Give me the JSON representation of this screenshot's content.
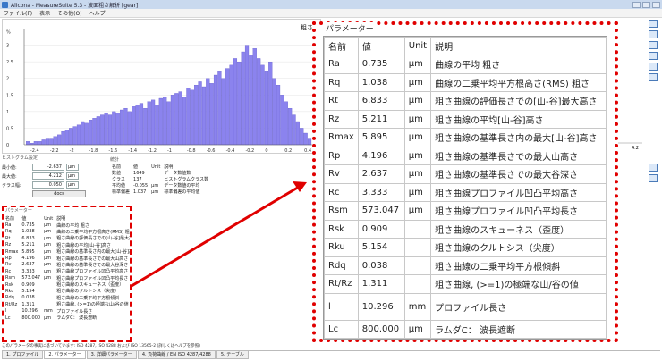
{
  "window": {
    "title": "Alicona - MeasureSuite 5.3 - 波面粗さ解析 [gear]"
  },
  "menu": [
    "ファイル(F)",
    "表示",
    "その他(O)",
    "ヘルプ"
  ],
  "chart": {
    "y_ticks": [
      "%",
      "3",
      "2.5",
      "2",
      "1.5",
      "1",
      "0.5",
      "0"
    ],
    "x_ticks": [
      "-2.4",
      "-2.2",
      "-2",
      "-1.8",
      "-1.6",
      "-1.4",
      "-1.2",
      "-1",
      "-0.8",
      "-0.6",
      "-0.4",
      "-0.2",
      "0",
      "0.2",
      "0.4"
    ],
    "extra_tick": "4.2",
    "right_label": "粗さ",
    "bar_color": "#8b83ee"
  },
  "chart_data": {
    "type": "bar",
    "x": [
      -2.48,
      -2.44,
      -2.4,
      -2.36,
      -2.32,
      -2.28,
      -2.24,
      -2.2,
      -2.16,
      -2.12,
      -2.08,
      -2.04,
      -2.0,
      -1.96,
      -1.92,
      -1.88,
      -1.84,
      -1.8,
      -1.76,
      -1.72,
      -1.68,
      -1.64,
      -1.6,
      -1.56,
      -1.52,
      -1.48,
      -1.44,
      -1.4,
      -1.36,
      -1.32,
      -1.28,
      -1.24,
      -1.2,
      -1.16,
      -1.12,
      -1.08,
      -1.04,
      -1.0,
      -0.96,
      -0.92,
      -0.88,
      -0.84,
      -0.8,
      -0.76,
      -0.72,
      -0.68,
      -0.64,
      -0.6,
      -0.56,
      -0.52,
      -0.48,
      -0.44,
      -0.4,
      -0.36,
      -0.32,
      -0.28,
      -0.24,
      -0.2,
      -0.16,
      -0.12,
      -0.08,
      -0.04,
      0.0,
      0.04,
      0.08,
      0.12,
      0.16,
      0.2,
      0.24,
      0.28,
      0.32,
      0.36,
      0.4
    ],
    "values": [
      0.1,
      0.05,
      0.1,
      0.1,
      0.15,
      0.2,
      0.2,
      0.25,
      0.3,
      0.4,
      0.45,
      0.5,
      0.55,
      0.6,
      0.7,
      0.65,
      0.75,
      0.8,
      0.85,
      0.9,
      0.95,
      0.9,
      1.0,
      0.95,
      1.05,
      1.1,
      1.0,
      1.15,
      1.2,
      1.25,
      1.1,
      1.3,
      1.35,
      1.2,
      1.4,
      1.45,
      1.3,
      1.5,
      1.55,
      1.6,
      1.45,
      1.7,
      1.65,
      1.8,
      1.9,
      1.75,
      2.0,
      1.85,
      2.1,
      2.2,
      2.0,
      2.3,
      2.4,
      2.6,
      2.5,
      2.8,
      3.0,
      2.7,
      2.9,
      2.6,
      2.4,
      2.2,
      2.5,
      2.0,
      1.8,
      1.5,
      1.3,
      1.1,
      0.9,
      0.7,
      0.5,
      0.35,
      0.2
    ],
    "ylim": [
      0,
      3.5
    ],
    "xlim": [
      -2.5,
      0.5
    ]
  },
  "hist_settings": {
    "header": "ヒストグラム設定",
    "rows": [
      {
        "label": "最小値:",
        "value": "-2.637",
        "unit": "μm"
      },
      {
        "label": "最大値:",
        "value": "4.212",
        "unit": "μm"
      },
      {
        "label": "クラス幅:",
        "value": "0.050",
        "unit": "μm"
      }
    ],
    "button": "docs"
  },
  "stats": {
    "header": "統計",
    "columns": [
      "名前",
      "値",
      "Unit",
      "説明"
    ],
    "rows": [
      [
        "数値",
        "1649",
        "",
        "データ数値数"
      ],
      [
        "クラス",
        "137",
        "",
        "ヒストグラムクラス数"
      ],
      [
        "平均値",
        "-0.055",
        "μm",
        "データ数値の平均"
      ],
      [
        "標準偏差",
        "1.037",
        "μm",
        "標準偏差の平均値"
      ]
    ]
  },
  "params": {
    "legend": "パラメーター",
    "columns": [
      "名前",
      "値",
      "Unit",
      "説明"
    ],
    "rows": [
      {
        "name": "Ra",
        "value": "0.735",
        "unit": "μm",
        "desc": "曲線の平均 粗さ"
      },
      {
        "name": "Rq",
        "value": "1.038",
        "unit": "μm",
        "desc": "曲線の二乗平均平方根高さ(RMS) 粗さ"
      },
      {
        "name": "Rt",
        "value": "6.833",
        "unit": "μm",
        "desc": "粗さ曲線の評価長さでの[山-谷]最大高さ"
      },
      {
        "name": "Rz",
        "value": "5.211",
        "unit": "μm",
        "desc": "粗さ曲線の平均[山-谷]高さ"
      },
      {
        "name": "Rmax",
        "value": "5.895",
        "unit": "μm",
        "desc": "粗さ曲線の基準長さ内の最大[山-谷]高さ"
      },
      {
        "name": "Rp",
        "value": "4.196",
        "unit": "μm",
        "desc": "粗さ曲線の基準長さでの最大山高さ"
      },
      {
        "name": "Rv",
        "value": "2.637",
        "unit": "μm",
        "desc": "粗さ曲線の基準長さでの最大谷深さ"
      },
      {
        "name": "Rc",
        "value": "3.333",
        "unit": "μm",
        "desc": "粗さ曲線プロファイル凹凸平均高さ"
      },
      {
        "name": "Rsm",
        "value": "573.047",
        "unit": "μm",
        "desc": "粗さ曲線プロファイル凹凸平均長さ"
      },
      {
        "name": "Rsk",
        "value": "0.909",
        "unit": "",
        "desc": "粗さ曲線のスキューネス（歪度）"
      },
      {
        "name": "Rku",
        "value": "5.154",
        "unit": "",
        "desc": "粗さ曲線のクルトシス（尖度）"
      },
      {
        "name": "Rdq",
        "value": "0.038",
        "unit": "",
        "desc": "粗さ曲線の二乗平均平方根傾斜"
      },
      {
        "name": "Rt/Rz",
        "value": "1.311",
        "unit": "",
        "desc": "粗さ曲線, (>=1)の極端な山/谷の値"
      },
      {
        "name": "l",
        "value": "10.296",
        "unit": "mm",
        "desc": "プロファイル長さ"
      },
      {
        "name": "Lc",
        "value": "800.000",
        "unit": "μm",
        "desc": "ラムダC： 波長遮断"
      }
    ]
  },
  "status_text": "このパラメータの事実に基づいています: ISO 4287, ISO 4288 および ISO 13565-2 (詳しくはヘルプを参照)",
  "tabs": [
    "1. プロファイル",
    "2. パラメーター",
    "3. 詳細パラメーター",
    "4. 負荷曲線 / EN ISO 4287/4288",
    "5. テーブル"
  ],
  "active_tab": 1
}
